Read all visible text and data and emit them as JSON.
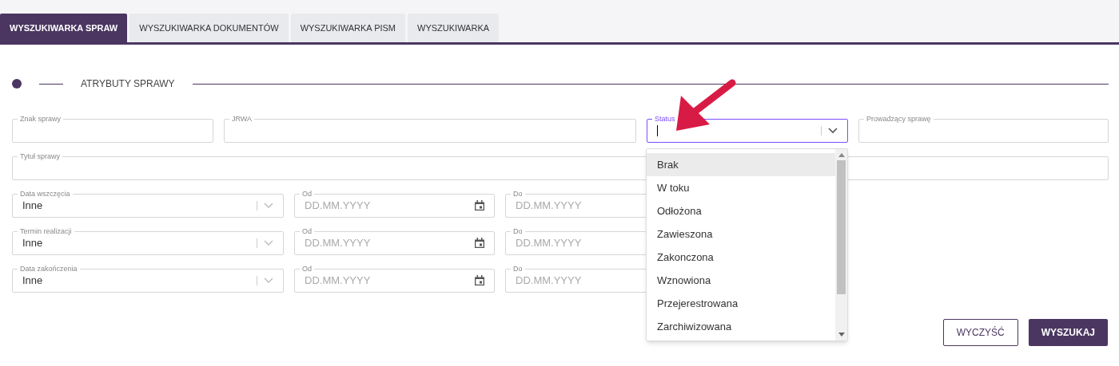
{
  "tabs": [
    {
      "label": "WYSZUKIWARKA SPRAW",
      "selected": true
    },
    {
      "label": "WYSZUKIWARKA DOKUMENTÓW",
      "selected": false
    },
    {
      "label": "WYSZUKIWARKA PISM",
      "selected": false
    },
    {
      "label": "WYSZUKIWARKA",
      "selected": false
    }
  ],
  "section_title": "ATRYBUTY SPRAWY",
  "top_fields": [
    {
      "label": "Znak sprawy",
      "kind": "text",
      "focused": false
    },
    {
      "label": "JRWA",
      "kind": "text",
      "focused": false
    },
    {
      "label": "Status",
      "kind": "select",
      "focused": true
    },
    {
      "label": "Prowadzący sprawę",
      "kind": "text",
      "focused": false
    }
  ],
  "title_field": {
    "label": "Tytuł sprawy"
  },
  "date_rows": [
    {
      "label": "Data wszczęcia",
      "value": "Inne",
      "from": {
        "label": "Od",
        "placeholder": "DD.MM.YYYY"
      },
      "to": {
        "label": "Do",
        "placeholder": "DD.MM.YYYY"
      }
    },
    {
      "label": "Termin realizacji",
      "value": "Inne",
      "from": {
        "label": "Od",
        "placeholder": "DD.MM.YYYY"
      },
      "to": {
        "label": "Do",
        "placeholder": "DD.MM.YYYY"
      }
    },
    {
      "label": "Data zakończenia",
      "value": "Inne",
      "from": {
        "label": "Od",
        "placeholder": "DD.MM.YYYY"
      },
      "to": {
        "label": "Do",
        "placeholder": "DD.MM.YYYY"
      }
    }
  ],
  "status_options": [
    {
      "label": "Brak",
      "selected": true
    },
    {
      "label": "W toku",
      "selected": false
    },
    {
      "label": "Odłożona",
      "selected": false
    },
    {
      "label": "Zawieszona",
      "selected": false
    },
    {
      "label": "Zakonczona",
      "selected": false
    },
    {
      "label": "Wznowiona",
      "selected": false
    },
    {
      "label": "Przejerestrowana",
      "selected": false
    },
    {
      "label": "Zarchiwizowana",
      "selected": false
    }
  ],
  "buttons": [
    {
      "label": "WYCZYŚĆ",
      "kind": "outline"
    },
    {
      "label": "WYSZUKAJ",
      "kind": "primary"
    }
  ]
}
